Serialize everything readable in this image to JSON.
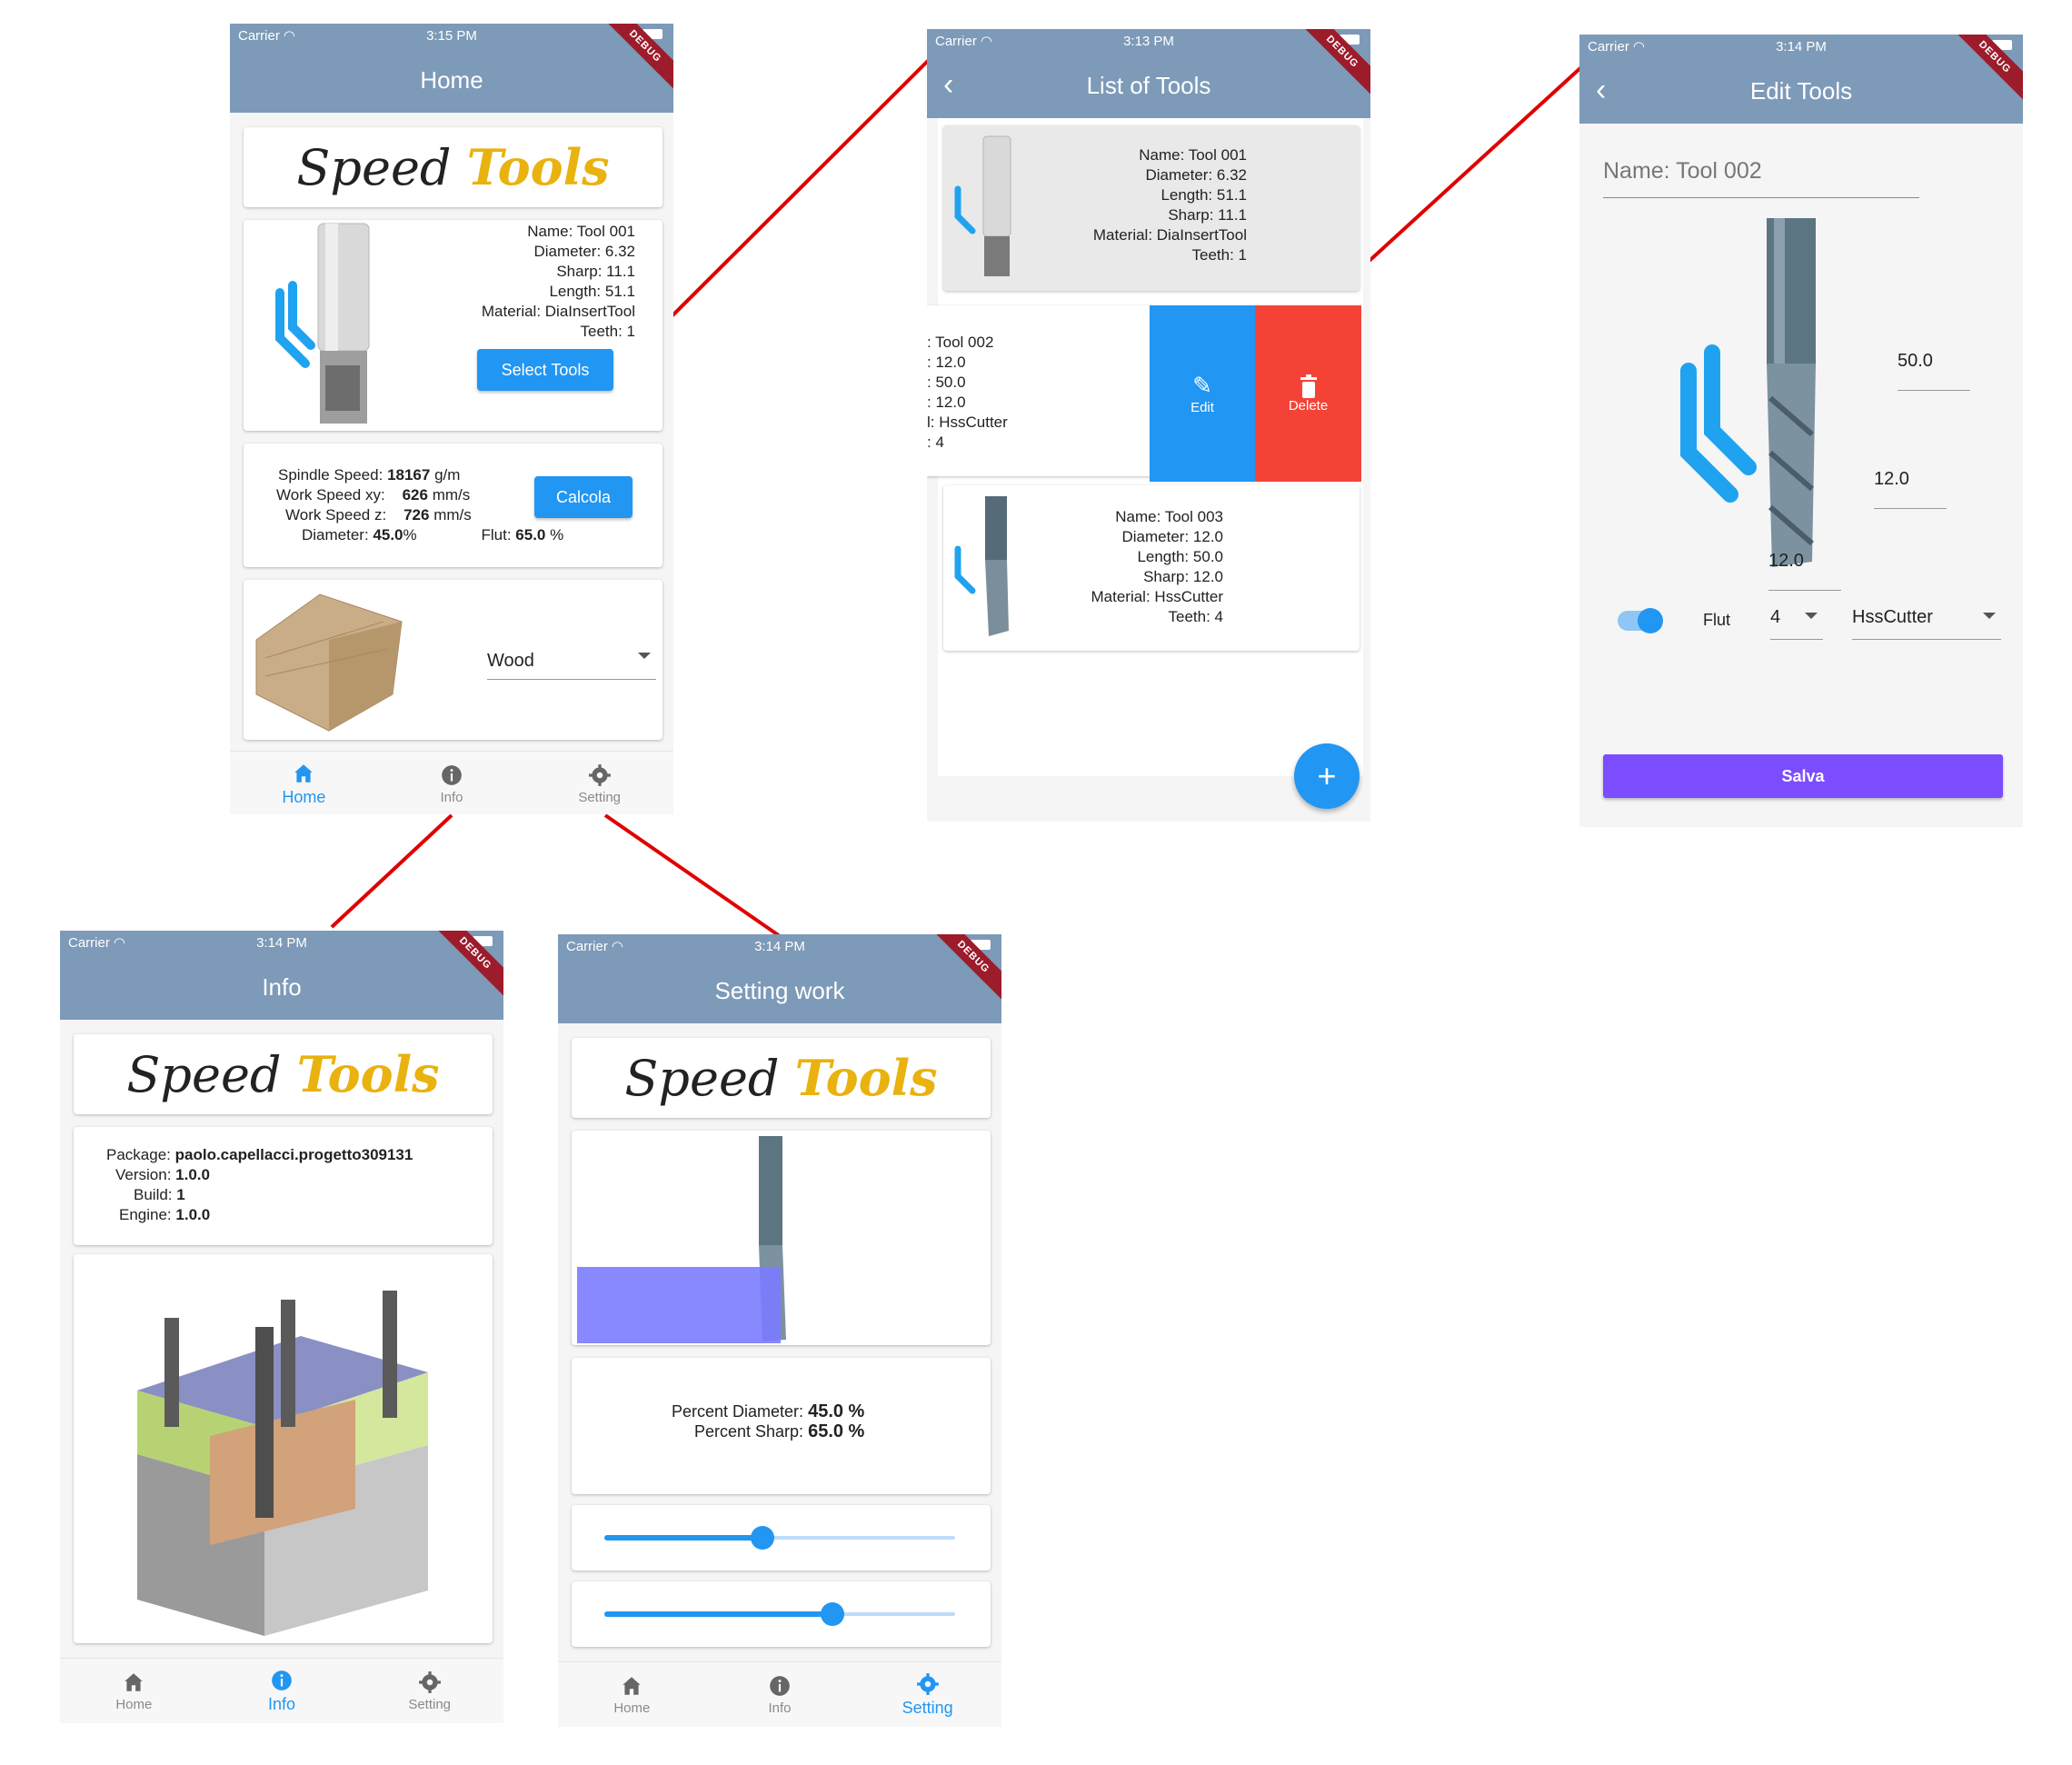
{
  "logo": {
    "speed": "Speed",
    "tools": "Tools"
  },
  "home": {
    "status_carrier": "Carrier",
    "status_time": "3:15 PM",
    "debug": "DEBUG",
    "title": "Home",
    "tool": {
      "name_label": "Name:",
      "name": "Tool 001",
      "diameter_label": "Diameter:",
      "diameter": "6.32",
      "sharp_label": "Sharp:",
      "sharp": "11.1",
      "length_label": "Length:",
      "length": "51.1",
      "material_label": "Material:",
      "material": "DiaInsertTool",
      "teeth_label": "Teeth:",
      "teeth": "1"
    },
    "select_tools_button": "Select Tools",
    "calc": {
      "spindle_label": "Spindle Speed:",
      "spindle_value": "18167",
      "spindle_unit": "g/m",
      "workxy_label": "Work Speed xy:",
      "workxy_value": "626",
      "workxy_unit": "mm/s",
      "workz_label": "Work Speed z:",
      "workz_value": "726",
      "workz_unit": "mm/s",
      "diam_label": "Diameter:",
      "diam_value": "45.0",
      "diam_unit": "%",
      "flut_label": "Flut:",
      "flut_value": "65.0",
      "flut_unit": "%"
    },
    "calcola_button": "Calcola",
    "material_selected": "Wood",
    "nav": {
      "home": "Home",
      "info": "Info",
      "setting": "Setting"
    }
  },
  "list": {
    "status_carrier": "Carrier",
    "status_time": "3:13 PM",
    "debug": "DEBUG",
    "title": "List of Tools",
    "tool1": {
      "name_label": "Name:",
      "name": "Tool 001",
      "diameter_label": "Diameter:",
      "diameter": "6.32",
      "length_label": "Length:",
      "length": "51.1",
      "sharp_label": "Sharp:",
      "sharp": "11.1",
      "material_label": "Material:",
      "material": "DiaInsertTool",
      "teeth_label": "Teeth:",
      "teeth": "1"
    },
    "tool2": {
      "l1": ": Tool 002",
      "l2": ": 12.0",
      "l3": ": 50.0",
      "l4": ": 12.0",
      "l5": "l: HssCutter",
      "l6": ": 4"
    },
    "edit_label": "Edit",
    "delete_label": "Delete",
    "tool3": {
      "name_label": "Name:",
      "name": "Tool 003",
      "diameter_label": "Diameter:",
      "diameter": "12.0",
      "length_label": "Length:",
      "length": "50.0",
      "sharp_label": "Sharp:",
      "sharp": "12.0",
      "material_label": "Material:",
      "material": "HssCutter",
      "teeth_label": "Teeth:",
      "teeth": "4"
    },
    "fab": "+"
  },
  "edit": {
    "status_carrier": "Carrier",
    "status_time": "3:14 PM",
    "debug": "DEBUG",
    "title": "Edit Tools",
    "name_field": "Name: Tool 002",
    "length_field": "50.0",
    "sharp_field": "12.0",
    "diameter_field": "12.0",
    "flut_label": "Flut",
    "teeth_selected": "4",
    "material_selected": "HssCutter",
    "save_button": "Salva",
    "toggle_on": true
  },
  "info": {
    "status_carrier": "Carrier",
    "status_time": "3:14 PM",
    "debug": "DEBUG",
    "title": "Info",
    "package_label": "Package:",
    "package": "paolo.capellacci.progetto309131",
    "version_label": "Version:",
    "version": "1.0.0",
    "build_label": "Build:",
    "build": "1",
    "engine_label": "Engine:",
    "engine": "1.0.0",
    "nav": {
      "home": "Home",
      "info": "Info",
      "setting": "Setting"
    }
  },
  "setting": {
    "status_carrier": "Carrier",
    "status_time": "3:14 PM",
    "debug": "DEBUG",
    "title": "Setting work",
    "pct_diam_label": "Percent Diameter:",
    "pct_diam_value": "45.0 %",
    "pct_sharp_label": "Percent Sharp:",
    "pct_sharp_value": "65.0 %",
    "slider1_value": 0.45,
    "slider2_value": 0.65,
    "nav": {
      "home": "Home",
      "info": "Info",
      "setting": "Setting"
    }
  },
  "colors": {
    "appbar": "#7d9ab8",
    "accent": "#2196f3",
    "delete": "#f44336",
    "save": "#7c4dff",
    "connector": "#e00000"
  }
}
